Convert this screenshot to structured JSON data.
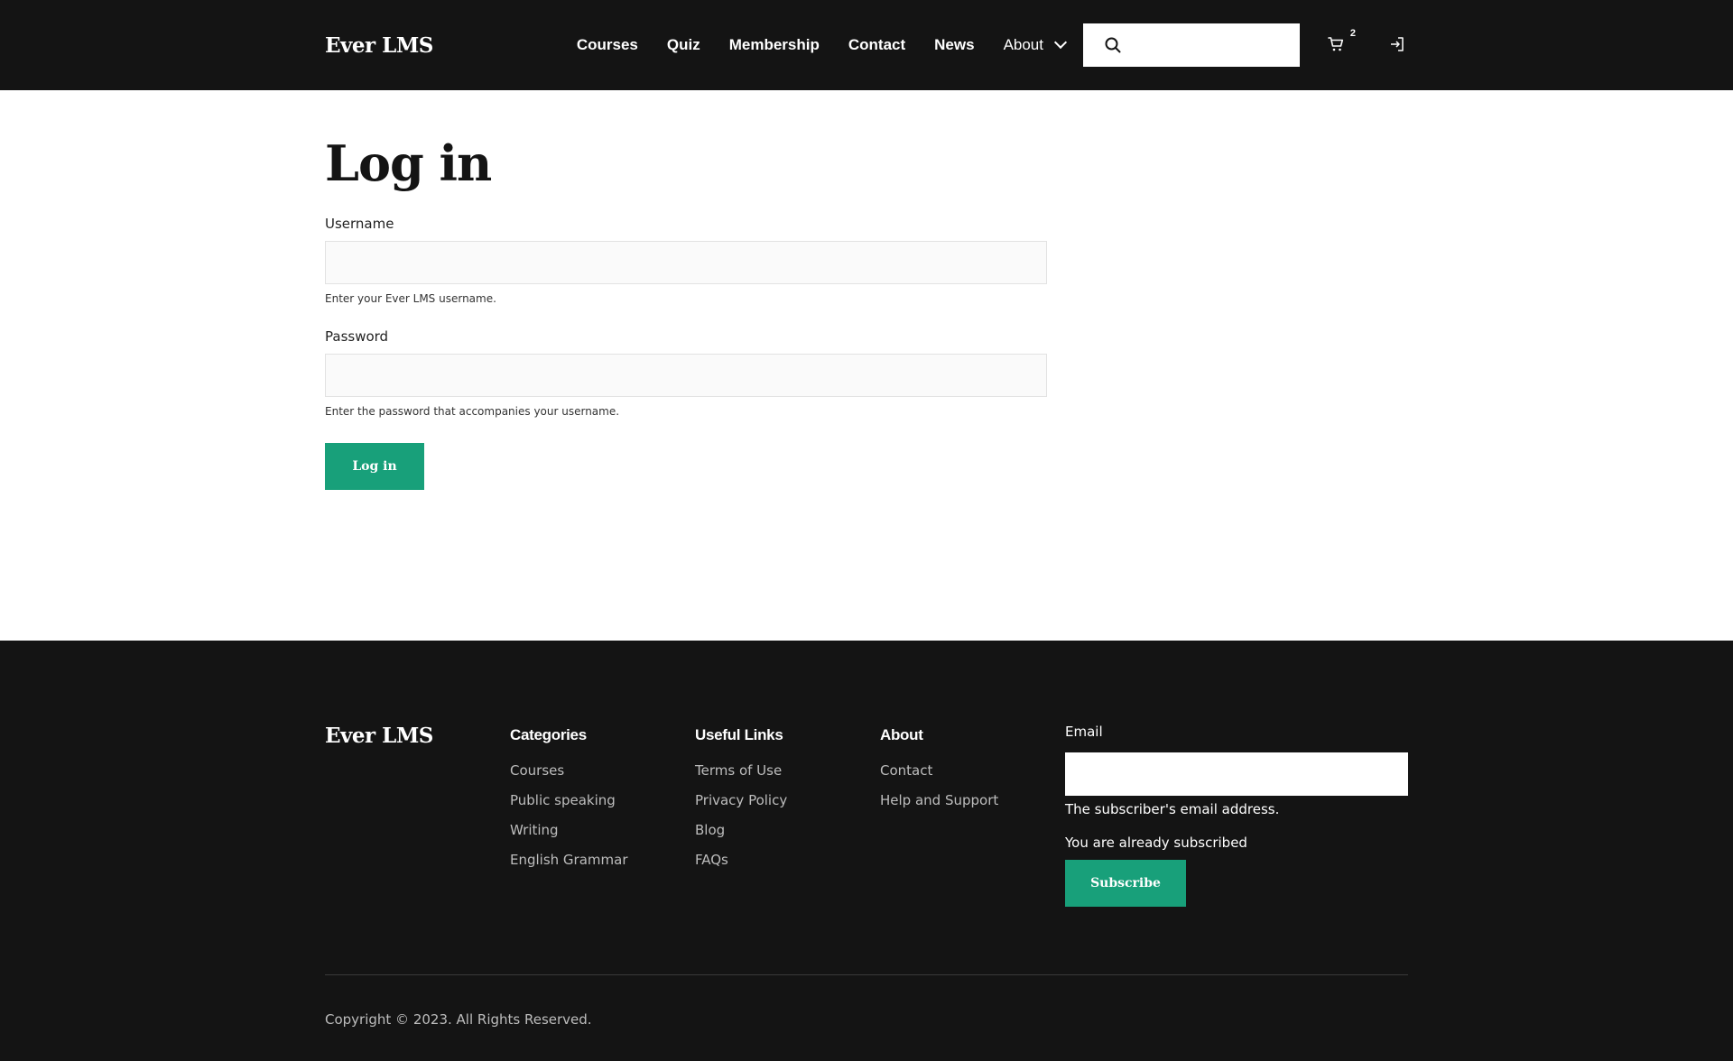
{
  "header": {
    "logo": "Ever LMS",
    "nav": [
      {
        "label": "Courses"
      },
      {
        "label": "Quiz"
      },
      {
        "label": "Membership"
      },
      {
        "label": "Contact"
      },
      {
        "label": "News"
      },
      {
        "label": "About",
        "has_dropdown": true
      }
    ],
    "search": {
      "placeholder": "",
      "value": "",
      "icon": "search-icon"
    },
    "cart": {
      "icon": "cart-icon",
      "count": "2"
    },
    "login_icon": "login-icon"
  },
  "main": {
    "title": "Log in",
    "username": {
      "label": "Username",
      "value": "",
      "help": "Enter your Ever LMS username."
    },
    "password": {
      "label": "Password",
      "value": "",
      "help": "Enter the password that accompanies your username."
    },
    "submit_label": "Log in"
  },
  "footer": {
    "logo": "Ever LMS",
    "columns": [
      {
        "title": "Categories",
        "links": [
          "Courses",
          "Public speaking",
          "Writing",
          "English Grammar"
        ]
      },
      {
        "title": "Useful Links",
        "links": [
          "Terms of Use",
          "Privacy Policy",
          "Blog",
          "FAQs"
        ]
      },
      {
        "title": "About",
        "links": [
          "Contact",
          "Help and Support"
        ]
      }
    ],
    "newsletter": {
      "label": "Email",
      "value": "",
      "help": "The subscriber's email address.",
      "status": "You are already subscribed",
      "button_label": "Subscribe"
    },
    "copyright": "Copyright © 2023. All Rights Reserved."
  },
  "colors": {
    "header_bg": "#141414",
    "footer_bg": "#141414",
    "accent": "#18a07a",
    "text": "#141414"
  }
}
